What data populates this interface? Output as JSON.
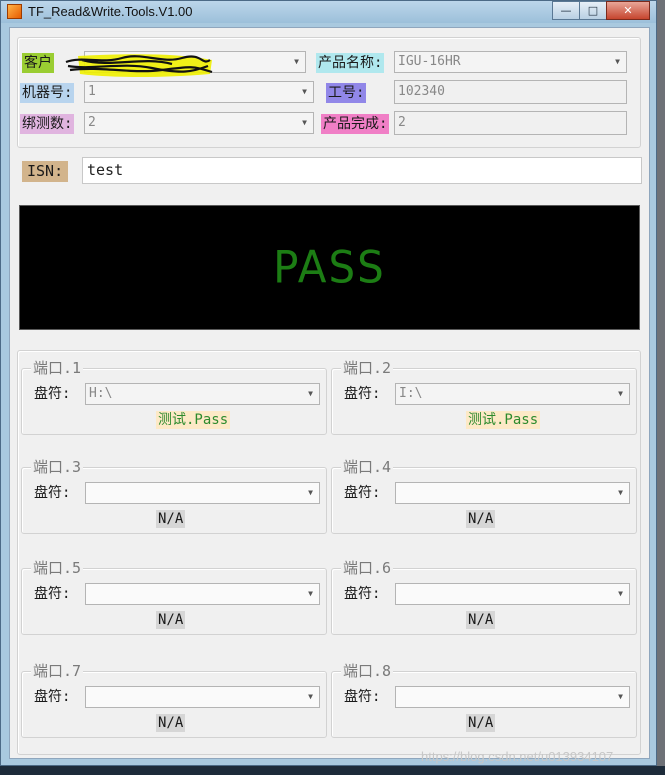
{
  "window": {
    "title": "TF_Read&Write.Tools.V1.00",
    "min_glyph": "—",
    "max_glyph": "□",
    "close_glyph": "✕"
  },
  "header": {
    "customer_label": "客户",
    "customer_value": "",
    "product_name_label": "产品名称:",
    "product_name_value": "IGU-16HR",
    "machine_label": "机器号:",
    "machine_value": "1",
    "work_no_label": "工号:",
    "work_no_value": "102340",
    "bind_count_label": "绑测数:",
    "bind_count_value": "2",
    "product_done_label": "产品完成:",
    "product_done_value": "2"
  },
  "isn": {
    "label": "ISN:",
    "value": "test"
  },
  "result": {
    "text": "PASS",
    "color": "#1c7d14"
  },
  "ports": [
    {
      "title": "端口.1",
      "drive_label": "盘符:",
      "drive_value": "H:\\",
      "status": "测试.Pass"
    },
    {
      "title": "端口.2",
      "drive_label": "盘符:",
      "drive_value": "I:\\",
      "status": "测试.Pass"
    },
    {
      "title": "端口.3",
      "drive_label": "盘符:",
      "drive_value": "",
      "status": "N/A"
    },
    {
      "title": "端口.4",
      "drive_label": "盘符:",
      "drive_value": "",
      "status": "N/A"
    },
    {
      "title": "端口.5",
      "drive_label": "盘符:",
      "drive_value": "",
      "status": "N/A"
    },
    {
      "title": "端口.6",
      "drive_label": "盘符:",
      "drive_value": "",
      "status": "N/A"
    },
    {
      "title": "端口.7",
      "drive_label": "盘符:",
      "drive_value": "",
      "status": "N/A"
    },
    {
      "title": "端口.8",
      "drive_label": "盘符:",
      "drive_value": "",
      "status": "N/A"
    }
  ],
  "colors": {
    "customer_label_bg": "#9acd32",
    "product_name_label_bg": "#b0e8ee",
    "machine_label_bg": "#b8d4ee",
    "work_no_label_bg": "#9187e8",
    "bind_count_label_bg": "#e0b4df",
    "product_done_label_bg": "#f07fc6",
    "isn_label_bg": "#d2b48c",
    "pass_status_bg": "#fde9c6",
    "pass_status_fg": "#2e8b2e",
    "na_status_bg": "#d6d6d6"
  },
  "watermark": "https://blog.csdn.net/u013934107"
}
